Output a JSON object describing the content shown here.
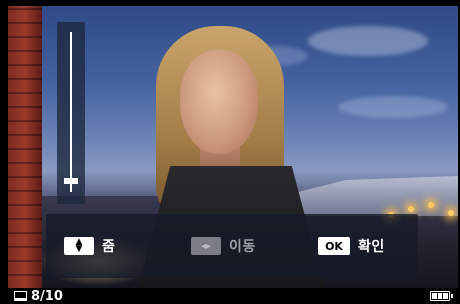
{
  "zoom": {
    "level": 0.05
  },
  "controls": {
    "zoom": {
      "icon": "up-down-arrows-icon",
      "label": "줌"
    },
    "move": {
      "icon": "left-right-arrows-icon",
      "label": "이동"
    },
    "confirm": {
      "key_label": "OK",
      "label": "확인"
    }
  },
  "status": {
    "frame_count": "8/10",
    "battery_bars": 3
  },
  "colors": {
    "panel_bg": "#141928",
    "accent": "#ffffff",
    "disabled": "#7a7d88"
  }
}
